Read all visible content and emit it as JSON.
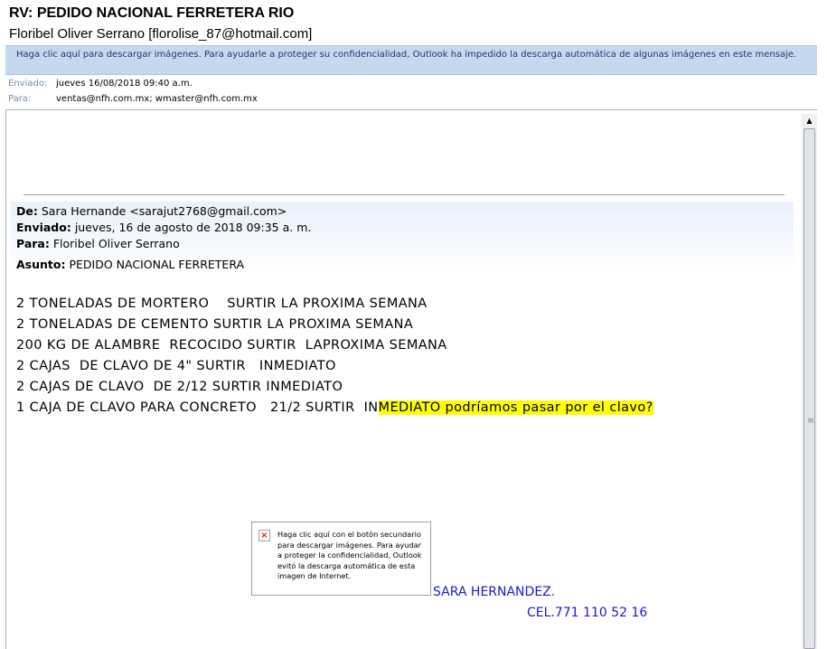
{
  "email": {
    "subject": "RV: PEDIDO NACIONAL FERRETERA RIO",
    "sender": "Floribel Oliver Serrano [florolise_87@hotmail.com]",
    "infobar_text": "Haga clic aquí para descargar imágenes. Para ayudarle a proteger su confidencialidad, Outlook ha impedido la descarga automática de algunas imágenes en este mensaje.",
    "sent_label": "Enviado:",
    "sent_value": "jueves 16/08/2018 09:40 a.m.",
    "to_label": "Para:",
    "to_value": "ventas@nfh.com.mx; wmaster@nfh.com.mx"
  },
  "forwarded": {
    "from_label": "De:",
    "from_value": "Sara Hernande <sarajut2768@gmail.com>",
    "sent_label": "Enviado:",
    "sent_value": "jueves, 16 de agosto de 2018 09:35 a. m.",
    "to_label": "Para:",
    "to_value": "Floribel Oliver Serrano",
    "subject_label": "Asunto:",
    "subject_value": "PEDIDO NACIONAL FERRETERA"
  },
  "order_lines": [
    "2 TONELADAS DE MORTERO    SURTIR LA PROXIMA SEMANA",
    "2 TONELADAS DE CEMENTO SURTIR LA PROXIMA SEMANA",
    "200 KG DE ALAMBRE  RECOCIDO SURTIR  LAPROXIMA SEMANA",
    "2 CAJAS  DE CLAVO DE 4\" SURTIR   INMEDIATO",
    "2 CAJAS DE CLAVO  DE 2/12 SURTIR INMEDIATO"
  ],
  "last_line": {
    "plain": "1 CAJA DE CLAVO PARA CONCRETO   21/2 SURTIR  IN",
    "highlighted": "MEDIATO podríamos pasar por el clavo?"
  },
  "blocked_image_text": "Haga clic aquí con el botón secundario para descargar imágenes. Para ayudar a proteger la confidencialidad, Outlook evitó la descarga automática de esta imagen de Internet.",
  "signature": {
    "name": "SARA HERNANDEZ.",
    "phone": "CEL.771 110 52 16"
  },
  "colors": {
    "infobar_bg": "#c5d8ee",
    "highlight": "#ffff00",
    "signature": "#1a1acc"
  }
}
